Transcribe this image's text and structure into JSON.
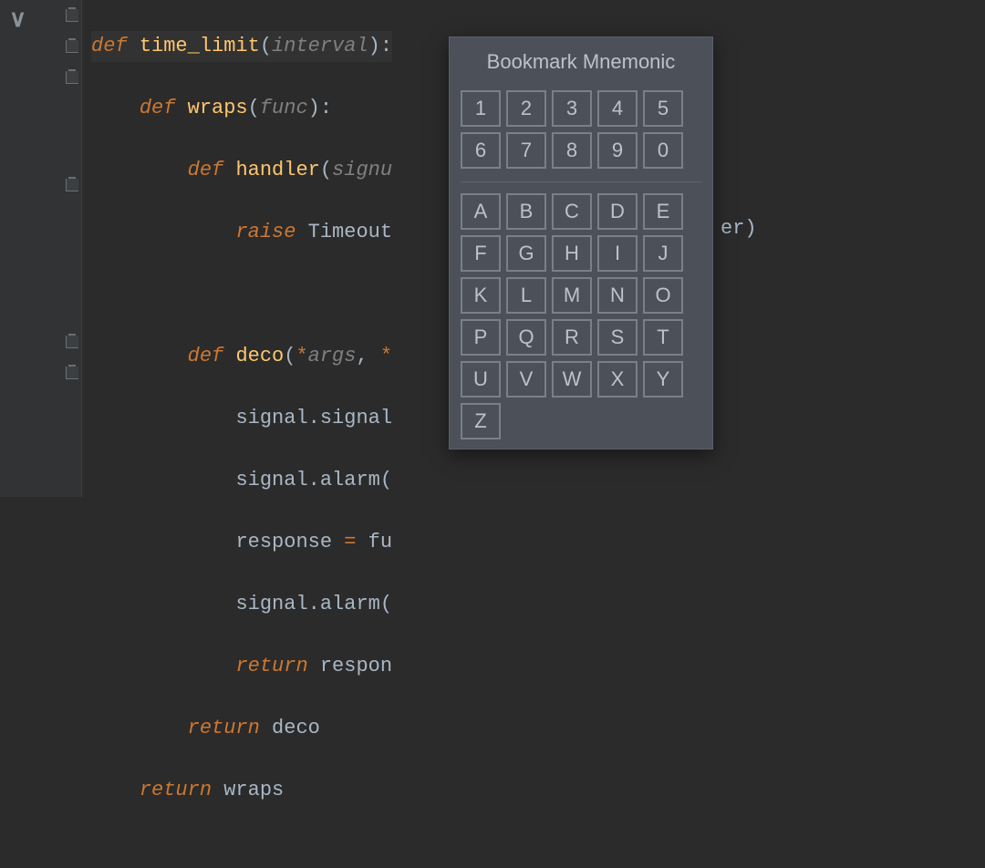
{
  "code": {
    "l1": {
      "kw": "def",
      "fn": "time_limit",
      "param": "interval"
    },
    "l2": {
      "kw": "def",
      "fn": "wraps",
      "param": "func"
    },
    "l3": {
      "kw": "def",
      "fn": "handler",
      "param": "signu"
    },
    "l4": {
      "kw": "raise",
      "ident": "Timeout"
    },
    "l5": {
      "kw": "def",
      "fn": "deco",
      "star1": "*",
      "p1": "args",
      "comma": ", ",
      "star2": "*"
    },
    "l6": {
      "expr": "signal.signal"
    },
    "l7": {
      "expr": "signal.alarm("
    },
    "l8": {
      "lhs": "response ",
      "op": "=",
      "rhs": " fu"
    },
    "l9": {
      "expr": "signal.alarm("
    },
    "l10": {
      "kw": "return",
      "ident": " respon"
    },
    "l11": {
      "kw": "return",
      "ident": " deco"
    },
    "l12": {
      "kw": "return",
      "ident": " wraps"
    },
    "trailing": "er)"
  },
  "popup": {
    "title": "Bookmark Mnemonic",
    "digits": [
      "1",
      "2",
      "3",
      "4",
      "5",
      "6",
      "7",
      "8",
      "9",
      "0"
    ],
    "letters": [
      "A",
      "B",
      "C",
      "D",
      "E",
      "F",
      "G",
      "H",
      "I",
      "J",
      "K",
      "L",
      "M",
      "N",
      "O",
      "P",
      "Q",
      "R",
      "S",
      "T",
      "U",
      "V",
      "W",
      "X",
      "Y",
      "Z"
    ]
  }
}
